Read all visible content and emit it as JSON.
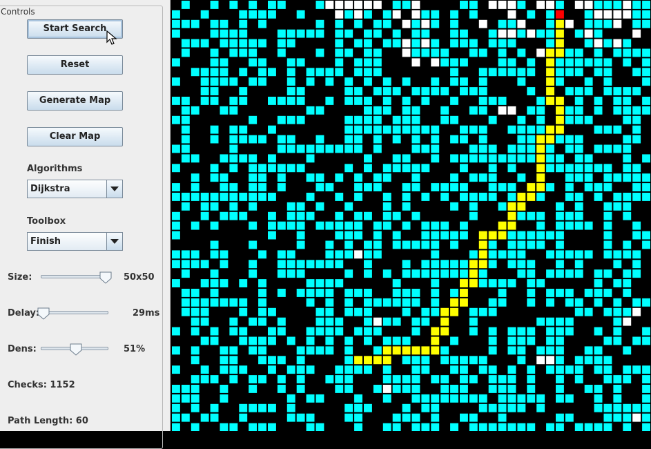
{
  "controls": {
    "title": "Controls",
    "start_label": "Start Search",
    "reset_label": "Reset",
    "generate_label": "Generate Map",
    "clear_label": "Clear Map",
    "algorithms_label": "Algorithms",
    "algorithm_selected": "Dijkstra",
    "toolbox_label": "Toolbox",
    "tool_selected": "Finish",
    "size_label": "Size:",
    "size_value": "50x50",
    "size_level": 0.95,
    "delay_label": "Delay:",
    "delay_value": "29ms",
    "delay_level": 0.03,
    "dens_label": "Dens:",
    "dens_value": "51%",
    "dens_level": 0.51,
    "checks_text": "Checks: 1152",
    "path_text": "Path Length: 60"
  },
  "map": {
    "colors": {
      "wall": "#000000",
      "explored": "#00ffff",
      "unexplored": "#ffffff",
      "path": "#ffff00",
      "finish": "#ff0000"
    },
    "finish": {
      "col": 40,
      "row": 1
    },
    "path": [
      [
        40,
        1
      ],
      [
        40,
        2
      ],
      [
        40,
        3
      ],
      [
        40,
        4
      ],
      [
        40,
        5
      ],
      [
        39,
        5
      ],
      [
        39,
        6
      ],
      [
        39,
        7
      ],
      [
        39,
        8
      ],
      [
        39,
        9
      ],
      [
        39,
        10
      ],
      [
        40,
        10
      ],
      [
        40,
        11
      ],
      [
        40,
        12
      ],
      [
        40,
        13
      ],
      [
        39,
        13
      ],
      [
        39,
        14
      ],
      [
        38,
        14
      ],
      [
        38,
        15
      ],
      [
        38,
        16
      ],
      [
        38,
        17
      ],
      [
        38,
        18
      ],
      [
        38,
        19
      ],
      [
        37,
        19
      ],
      [
        37,
        20
      ],
      [
        36,
        20
      ],
      [
        36,
        21
      ],
      [
        35,
        21
      ],
      [
        35,
        22
      ],
      [
        35,
        23
      ],
      [
        34,
        23
      ],
      [
        34,
        24
      ],
      [
        33,
        24
      ],
      [
        32,
        24
      ],
      [
        32,
        25
      ],
      [
        32,
        26
      ],
      [
        32,
        27
      ],
      [
        31,
        27
      ],
      [
        31,
        28
      ],
      [
        31,
        29
      ],
      [
        30,
        29
      ],
      [
        30,
        30
      ],
      [
        30,
        31
      ],
      [
        29,
        31
      ],
      [
        29,
        32
      ],
      [
        28,
        32
      ],
      [
        28,
        33
      ],
      [
        28,
        34
      ],
      [
        27,
        34
      ],
      [
        27,
        35
      ],
      [
        27,
        36
      ],
      [
        26,
        36
      ],
      [
        25,
        36
      ],
      [
        24,
        36
      ],
      [
        23,
        36
      ],
      [
        22,
        36
      ],
      [
        22,
        37
      ],
      [
        21,
        37
      ],
      [
        20,
        37
      ],
      [
        19,
        37
      ]
    ],
    "open_cells": [
      [
        16,
        0
      ],
      [
        17,
        0
      ],
      [
        18,
        0
      ],
      [
        19,
        0
      ],
      [
        20,
        0
      ],
      [
        21,
        0
      ],
      [
        25,
        0
      ],
      [
        33,
        0
      ],
      [
        34,
        0
      ],
      [
        35,
        0
      ],
      [
        38,
        0
      ],
      [
        39,
        0
      ],
      [
        42,
        0
      ],
      [
        43,
        0
      ],
      [
        47,
        0
      ],
      [
        17,
        1
      ],
      [
        19,
        1
      ],
      [
        23,
        1
      ],
      [
        25,
        1
      ],
      [
        35,
        1
      ],
      [
        44,
        1
      ],
      [
        45,
        1
      ],
      [
        46,
        1
      ],
      [
        47,
        1
      ],
      [
        24,
        2
      ],
      [
        26,
        2
      ],
      [
        32,
        2
      ],
      [
        36,
        2
      ],
      [
        41,
        2
      ],
      [
        46,
        2
      ],
      [
        34,
        3
      ],
      [
        35,
        3
      ],
      [
        37,
        3
      ],
      [
        43,
        3
      ],
      [
        48,
        3
      ],
      [
        24,
        4
      ],
      [
        26,
        4
      ],
      [
        44,
        4
      ],
      [
        46,
        4
      ],
      [
        24,
        5
      ],
      [
        38,
        5
      ],
      [
        25,
        6
      ],
      [
        27,
        6
      ],
      [
        34,
        11
      ],
      [
        35,
        11
      ],
      [
        19,
        26
      ],
      [
        21,
        33
      ],
      [
        48,
        32
      ],
      [
        47,
        33
      ],
      [
        38,
        37
      ],
      [
        39,
        37
      ],
      [
        22,
        40
      ],
      [
        48,
        43
      ]
    ]
  }
}
